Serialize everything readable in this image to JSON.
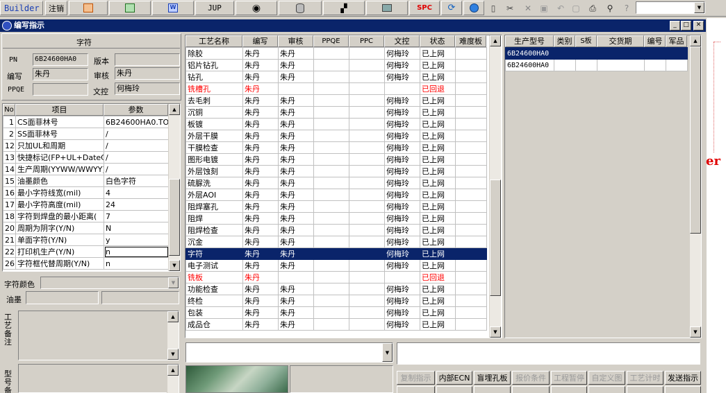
{
  "toolbar": {
    "builder_label": "Builder",
    "logout_label": "注销",
    "jup_label": "JUP",
    "spc_label": "SPC"
  },
  "window": {
    "title": "编写指示"
  },
  "form": {
    "section_title": "字符",
    "pn_label": "PN",
    "pn_value": "6B24600HA0",
    "version_label": "版本",
    "version_value": "",
    "writer_label": "编写",
    "writer_value": "朱丹",
    "reviewer_label": "审核",
    "reviewer_value": "朱丹",
    "ppqe_label": "PPQE",
    "ppqe_value": "",
    "doc_label": "文控",
    "doc_value": "何梅玲"
  },
  "params": {
    "headers": [
      "No",
      "项目",
      "参数"
    ],
    "rows": [
      {
        "no": "1",
        "item": "CS面菲林号",
        "value": "6B24600HA0.TO"
      },
      {
        "no": "2",
        "item": "SS面菲林号",
        "value": "/"
      },
      {
        "no": "12",
        "item": "只加UL和周期",
        "value": "/"
      },
      {
        "no": "13",
        "item": "快捷标记(FP+UL+DateCo",
        "value": "/"
      },
      {
        "no": "14",
        "item": "生产周期(YYWW/WWYY)",
        "value": "/"
      },
      {
        "no": "15",
        "item": "油墨颜色",
        "value": "白色字符"
      },
      {
        "no": "16",
        "item": "最小字符线宽(mil)",
        "value": "4"
      },
      {
        "no": "17",
        "item": "最小字符高度(mil)",
        "value": "24"
      },
      {
        "no": "18",
        "item": "字符到焊盘的最小距离(",
        "value": "7"
      },
      {
        "no": "20",
        "item": "周期为阴字(Y/N)",
        "value": "N"
      },
      {
        "no": "21",
        "item": "单面字符(Y/N)",
        "value": "y"
      },
      {
        "no": "22",
        "item": "打印机生产(Y/N)",
        "value": "n"
      },
      {
        "no": "26",
        "item": "字符框代替周期(Y/N)",
        "value": "n"
      }
    ]
  },
  "lower_left": {
    "char_color_label": "字符颜色",
    "ink_label": "油墨",
    "process_note_label": "工艺备注",
    "model_label": "型号备注"
  },
  "process": {
    "headers": [
      "工艺名称",
      "编写",
      "审核",
      "PPQE",
      "PPC",
      "文控",
      "状态",
      "难度板"
    ],
    "rows": [
      {
        "name": "除胶",
        "writer": "朱丹",
        "reviewer": "朱丹",
        "ppqe": "",
        "ppc": "",
        "doc": "何梅玲",
        "status": "已上网",
        "difficulty": ""
      },
      {
        "name": "铝片钻孔",
        "writer": "朱丹",
        "reviewer": "朱丹",
        "ppqe": "",
        "ppc": "",
        "doc": "何梅玲",
        "status": "已上网",
        "difficulty": ""
      },
      {
        "name": "钻孔",
        "writer": "朱丹",
        "reviewer": "朱丹",
        "ppqe": "",
        "ppc": "",
        "doc": "何梅玲",
        "status": "已上网",
        "difficulty": ""
      },
      {
        "name": "铣槽孔",
        "writer": "朱丹",
        "reviewer": "",
        "ppqe": "",
        "ppc": "",
        "doc": "",
        "status": "已回退",
        "difficulty": ""
      },
      {
        "name": "去毛刺",
        "writer": "朱丹",
        "reviewer": "朱丹",
        "ppqe": "",
        "ppc": "",
        "doc": "何梅玲",
        "status": "已上网",
        "difficulty": ""
      },
      {
        "name": "沉铜",
        "writer": "朱丹",
        "reviewer": "朱丹",
        "ppqe": "",
        "ppc": "",
        "doc": "何梅玲",
        "status": "已上网",
        "difficulty": ""
      },
      {
        "name": "板镀",
        "writer": "朱丹",
        "reviewer": "朱丹",
        "ppqe": "",
        "ppc": "",
        "doc": "何梅玲",
        "status": "已上网",
        "difficulty": ""
      },
      {
        "name": "外层干膜",
        "writer": "朱丹",
        "reviewer": "朱丹",
        "ppqe": "",
        "ppc": "",
        "doc": "何梅玲",
        "status": "已上网",
        "difficulty": ""
      },
      {
        "name": "干膜检查",
        "writer": "朱丹",
        "reviewer": "朱丹",
        "ppqe": "",
        "ppc": "",
        "doc": "何梅玲",
        "status": "已上网",
        "difficulty": ""
      },
      {
        "name": "图形电镀",
        "writer": "朱丹",
        "reviewer": "朱丹",
        "ppqe": "",
        "ppc": "",
        "doc": "何梅玲",
        "status": "已上网",
        "difficulty": ""
      },
      {
        "name": "外层蚀刻",
        "writer": "朱丹",
        "reviewer": "朱丹",
        "ppqe": "",
        "ppc": "",
        "doc": "何梅玲",
        "status": "已上网",
        "difficulty": ""
      },
      {
        "name": "硫脲洗",
        "writer": "朱丹",
        "reviewer": "朱丹",
        "ppqe": "",
        "ppc": "",
        "doc": "何梅玲",
        "status": "已上网",
        "difficulty": ""
      },
      {
        "name": "外层AOI",
        "writer": "朱丹",
        "reviewer": "朱丹",
        "ppqe": "",
        "ppc": "",
        "doc": "何梅玲",
        "status": "已上网",
        "difficulty": ""
      },
      {
        "name": "阻焊塞孔",
        "writer": "朱丹",
        "reviewer": "朱丹",
        "ppqe": "",
        "ppc": "",
        "doc": "何梅玲",
        "status": "已上网",
        "difficulty": ""
      },
      {
        "name": "阻焊",
        "writer": "朱丹",
        "reviewer": "朱丹",
        "ppqe": "",
        "ppc": "",
        "doc": "何梅玲",
        "status": "已上网",
        "difficulty": ""
      },
      {
        "name": "阻焊检查",
        "writer": "朱丹",
        "reviewer": "朱丹",
        "ppqe": "",
        "ppc": "",
        "doc": "何梅玲",
        "status": "已上网",
        "difficulty": ""
      },
      {
        "name": "沉金",
        "writer": "朱丹",
        "reviewer": "朱丹",
        "ppqe": "",
        "ppc": "",
        "doc": "何梅玲",
        "status": "已上网",
        "difficulty": ""
      },
      {
        "name": "字符",
        "writer": "朱丹",
        "reviewer": "朱丹",
        "ppqe": "",
        "ppc": "",
        "doc": "何梅玲",
        "status": "已上网",
        "difficulty": ""
      },
      {
        "name": "电子测试",
        "writer": "朱丹",
        "reviewer": "朱丹",
        "ppqe": "",
        "ppc": "",
        "doc": "何梅玲",
        "status": "已上网",
        "difficulty": ""
      },
      {
        "name": "铣板",
        "writer": "朱丹",
        "reviewer": "",
        "ppqe": "",
        "ppc": "",
        "doc": "",
        "status": "已回退",
        "difficulty": ""
      },
      {
        "name": "功能检查",
        "writer": "朱丹",
        "reviewer": "朱丹",
        "ppqe": "",
        "ppc": "",
        "doc": "何梅玲",
        "status": "已上网",
        "difficulty": ""
      },
      {
        "name": "终检",
        "writer": "朱丹",
        "reviewer": "朱丹",
        "ppqe": "",
        "ppc": "",
        "doc": "何梅玲",
        "status": "已上网",
        "difficulty": ""
      },
      {
        "name": "包装",
        "writer": "朱丹",
        "reviewer": "朱丹",
        "ppqe": "",
        "ppc": "",
        "doc": "何梅玲",
        "status": "已上网",
        "difficulty": ""
      },
      {
        "name": "成品仓",
        "writer": "朱丹",
        "reviewer": "朱丹",
        "ppqe": "",
        "ppc": "",
        "doc": "何梅玲",
        "status": "已上网",
        "difficulty": ""
      }
    ]
  },
  "models": {
    "headers": [
      "生产型号",
      "类别",
      "S板",
      "交货期",
      "编号",
      "军品"
    ],
    "rows": [
      {
        "model": "6B24600HA0",
        "category": "",
        "sboard": "",
        "delivery": "",
        "code": "",
        "military": ""
      },
      {
        "model": "6B24600HA0",
        "category": "",
        "sboard": "",
        "delivery": "",
        "code": "",
        "military": ""
      }
    ]
  },
  "buttons": {
    "copy": "复制指示",
    "internal_ecn": "内部ECN",
    "blind_hole": "盲埋孔板",
    "quote": "报价条件",
    "eng_pause": "工程暂停",
    "custom_view": "自定义图",
    "process_timer": "工艺计时",
    "send": "发送指示"
  },
  "bg_fragment": "er"
}
